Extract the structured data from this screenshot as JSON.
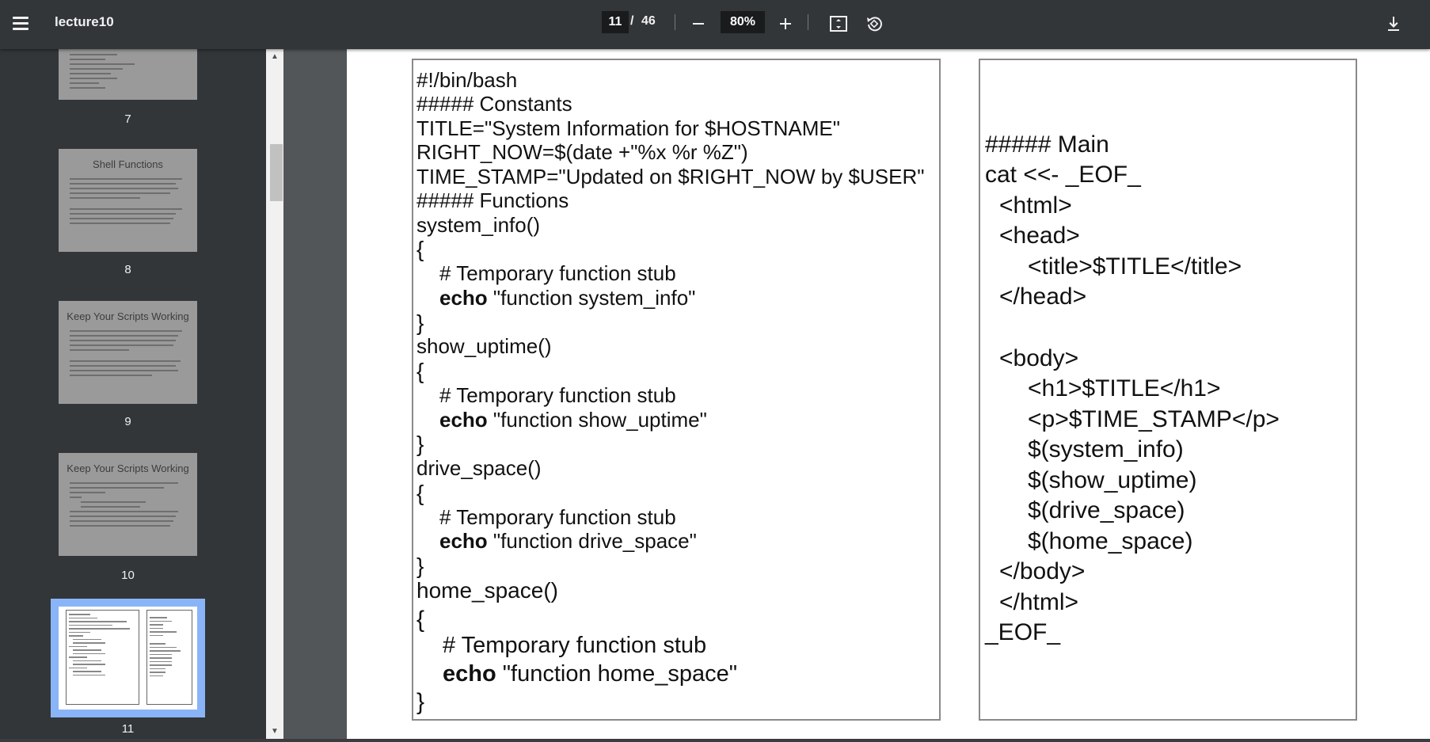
{
  "toolbar": {
    "title": "lecture10",
    "current_page": "11",
    "page_sep": "/",
    "total_pages": "46",
    "zoom": "80%"
  },
  "thumbnails": [
    {
      "number": "7",
      "title": ""
    },
    {
      "number": "8",
      "title": "Shell Functions"
    },
    {
      "number": "9",
      "title": "Keep Your Scripts Working"
    },
    {
      "number": "10",
      "title": "Keep Your Scripts Working"
    },
    {
      "number": "11",
      "title": ""
    }
  ],
  "left_code": {
    "l1": "#!/bin/bash",
    "l2": "##### Constants",
    "l3": "TITLE=\"System Information for $HOSTNAME\"",
    "l4": "RIGHT_NOW=$(date +\"%x %r %Z\")",
    "l5": "TIME_STAMP=\"Updated on $RIGHT_NOW by $USER\"",
    "l6": "##### Functions",
    "l7": "system_info()",
    "l8": "{",
    "l9": "# Temporary function stub",
    "l10_kw": "echo",
    "l10_rest": " \"function system_info\"",
    "l11": "}",
    "l12": "show_uptime()",
    "l13": "{",
    "l14": "# Temporary function stub",
    "l15_kw": "echo",
    "l15_rest": " \"function show_uptime\"",
    "l16": "}",
    "l17": "drive_space()",
    "l18": "{",
    "l19": "# Temporary function stub",
    "l20_kw": "echo",
    "l20_rest": " \"function drive_space\"",
    "l21": "}",
    "l22": "home_space()",
    "l23": "{",
    "l24": "# Temporary function stub",
    "l25_kw": "echo",
    "l25_rest": " \"function home_space\"",
    "l26": "}"
  },
  "right_code": {
    "r1": "##### Main",
    "r2": "cat <<- _EOF_",
    "r3": "<html>",
    "r4": "<head>",
    "r5": "<title>$TITLE</title>",
    "r6": "</head>",
    "r7": "<body>",
    "r8": "<h1>$TITLE</h1>",
    "r9": "<p>$TIME_STAMP</p>",
    "r10": "$(system_info)",
    "r11": "$(show_uptime)",
    "r12": "$(drive_space)",
    "r13": "$(home_space)",
    "r14": "</body>",
    "r15": "</html>",
    "r16": "_EOF_"
  }
}
